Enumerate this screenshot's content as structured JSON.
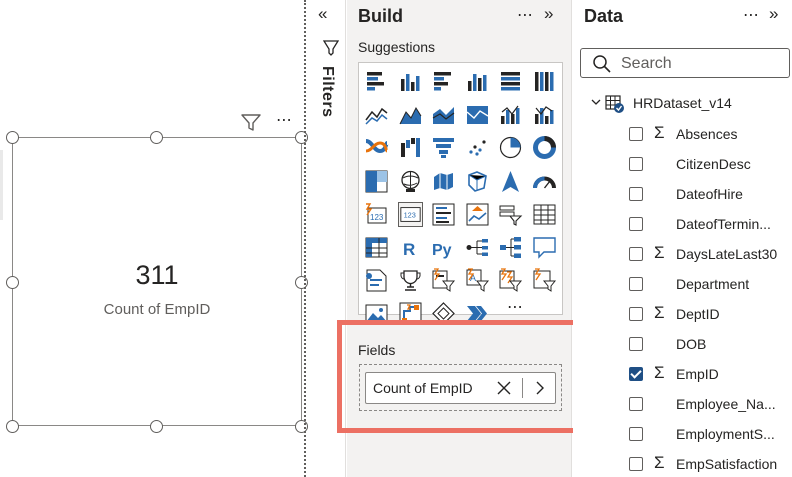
{
  "card": {
    "value": "311",
    "label": "Count of EmpID",
    "more_label": "⋯"
  },
  "filters": {
    "collapse_label": "«",
    "label": "Filters"
  },
  "build": {
    "title": "Build",
    "more_label": "⋯",
    "expand_label": "»",
    "suggestions_label": "Suggestions",
    "gallery_more": "⋯",
    "fields_label": "Fields",
    "field_pill": "Count of EmpID",
    "visuals": [
      "stacked-bar-chart-icon",
      "stacked-column-chart-icon",
      "clustered-bar-chart-icon",
      "clustered-column-chart-icon",
      "100-stacked-bar-chart-icon",
      "100-stacked-column-chart-icon",
      "line-chart-icon",
      "area-chart-icon",
      "stacked-area-chart-icon",
      "100-stacked-area-chart-icon",
      "line-and-column-chart-icon",
      "line-and-clustered-column-chart-icon",
      "ribbon-chart-icon",
      "waterfall-chart-icon",
      "funnel-chart-icon",
      "scatter-chart-icon",
      "pie-chart-icon",
      "donut-chart-icon",
      "treemap-icon",
      "map-icon",
      "filled-map-icon",
      "shape-map-icon",
      "azure-map-icon",
      "gauge-icon",
      "card-new-icon",
      "card-icon",
      "multi-row-card-icon",
      "kpi-icon",
      "slicer-icon",
      "table-icon",
      "matrix-icon",
      "r-visual-icon",
      "python-visual-icon",
      "key-influencers-icon",
      "decomposition-tree-icon",
      "qa-icon",
      "narrative-icon",
      "metrics-icon",
      "paginated-report-icon",
      "power-apps-icon",
      "power-automate-icon",
      "azure-map-visual-icon",
      "image-visual-icon",
      "power-automate-flow-icon",
      "arcgis-icon",
      "chevron-visual-icon"
    ]
  },
  "data": {
    "title": "Data",
    "more_label": "⋯",
    "expand_label": "»",
    "search_placeholder": "Search",
    "table_name": "HRDataset_v14",
    "fields": [
      {
        "name": "Absences",
        "sigma": true,
        "checked": false
      },
      {
        "name": "CitizenDesc",
        "sigma": false,
        "checked": false
      },
      {
        "name": "DateofHire",
        "sigma": false,
        "checked": false
      },
      {
        "name": "DateofTermin...",
        "sigma": false,
        "checked": false
      },
      {
        "name": "DaysLateLast30",
        "sigma": true,
        "checked": false
      },
      {
        "name": "Department",
        "sigma": false,
        "checked": false
      },
      {
        "name": "DeptID",
        "sigma": true,
        "checked": false
      },
      {
        "name": "DOB",
        "sigma": false,
        "checked": false
      },
      {
        "name": "EmpID",
        "sigma": true,
        "checked": true
      },
      {
        "name": "Employee_Na...",
        "sigma": false,
        "checked": false
      },
      {
        "name": "EmploymentS...",
        "sigma": false,
        "checked": false
      },
      {
        "name": "EmpSatisfaction",
        "sigma": true,
        "checked": false
      }
    ],
    "sigma_symbol": "Σ"
  },
  "colors": {
    "accent_blue": "#2b6cb0",
    "checked_blue": "#1f4f85",
    "highlight_box": "#ec7063",
    "pane_gray": "#f3f2f1",
    "warning_orange": "#e8730c"
  }
}
